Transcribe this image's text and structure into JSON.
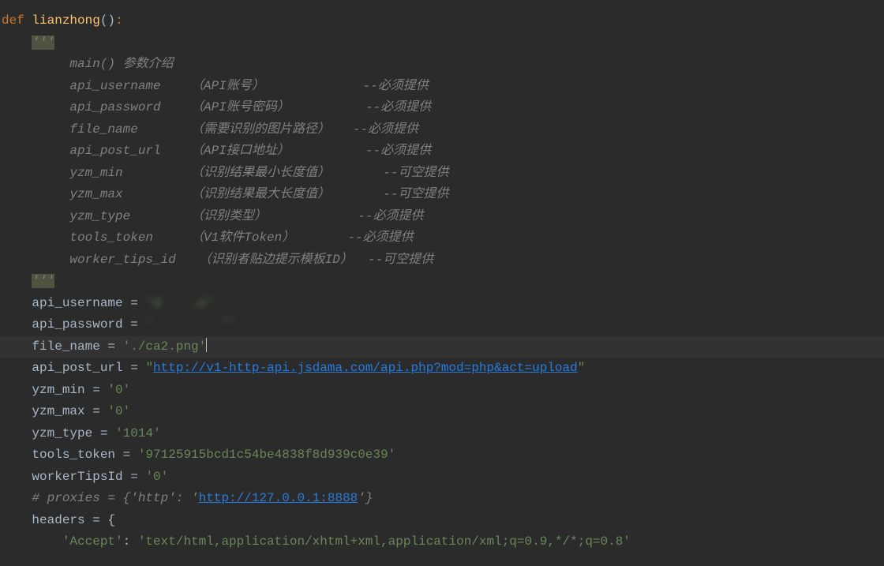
{
  "code": {
    "line1": {
      "def": "def ",
      "funcname": "lianzhong",
      "parens": "()",
      "colon": ":"
    },
    "docstring_open": "    '''",
    "doc_lines": [
      "         main() 参数介绍",
      "         api_username    （API账号）             --必须提供",
      "         api_password    （API账号密码）          --必须提供",
      "         file_name       （需要识别的图片路径）   --必须提供",
      "         api_post_url    （API接口地址）          --必须提供",
      "         yzm_min         （识别结果最小长度值）       --可空提供",
      "         yzm_max         （识别结果最大长度值）       --可空提供",
      "         yzm_type        （识别类型）            --必须提供",
      "         tools_token     （V1软件Token）       --必须提供",
      "         worker_tips_id   （识别者贴边提示模板ID）  --可空提供"
    ],
    "docstring_close": "    '''",
    "assignments": {
      "api_username": {
        "var": "    api_username ",
        "eq": "= ",
        "val": "'d    .o'"
      },
      "api_password": {
        "var": "    api_password ",
        "eq": "= ",
        "val": "'         ''"
      },
      "file_name": {
        "var": "    file_name ",
        "eq": "= ",
        "val": "'./ca2.png'"
      },
      "api_post_url": {
        "var": "    api_post_url ",
        "eq": "= ",
        "quote1": "\"",
        "url": "http://v1-http-api.jsdama.com/api.php?mod=php&act=upload",
        "quote2": "\""
      },
      "yzm_min": {
        "var": "    yzm_min ",
        "eq": "= ",
        "val": "'0'"
      },
      "yzm_max": {
        "var": "    yzm_max ",
        "eq": "= ",
        "val": "'0'"
      },
      "yzm_type": {
        "var": "    yzm_type ",
        "eq": "= ",
        "val": "'1014'"
      },
      "tools_token": {
        "var": "    tools_token ",
        "eq": "= ",
        "val": "'97125915bcd1c54be4838f8d939c0e39'"
      },
      "workerTipsId": {
        "var": "    workerTipsId ",
        "eq": "= ",
        "val": "'0'"
      }
    },
    "blank": "",
    "proxies_comment": {
      "prefix": "    # proxies = {'http': '",
      "url": "http://127.0.0.1:8888",
      "suffix": "'}"
    },
    "headers_line": {
      "var": "    headers ",
      "eq": "= ",
      "brace": "{"
    },
    "accept_line": {
      "indent": "        ",
      "key": "'Accept'",
      "colon": ": ",
      "val": "'text/html,application/xhtml+xml,application/xml;q=0.9,*/*;q=0.8'"
    }
  }
}
